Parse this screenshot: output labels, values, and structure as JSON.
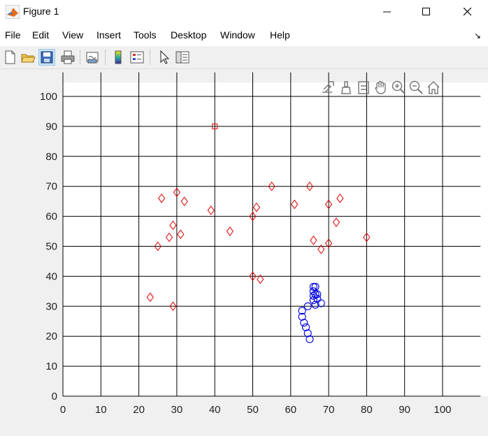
{
  "window": {
    "title": "Figure 1"
  },
  "menu": [
    "File",
    "Edit",
    "View",
    "Insert",
    "Tools",
    "Desktop",
    "Window",
    "Help"
  ],
  "toolbar_icons": [
    "new-figure-icon",
    "open-file-icon",
    "save-icon",
    "print-icon",
    "link-plot-icon",
    "insert-colorbar-icon",
    "insert-legend-icon",
    "edit-plot-icon",
    "property-inspector-icon"
  ],
  "axes_toolbar_icons": [
    "export-icon",
    "brush-icon",
    "data-tips-icon",
    "pan-icon",
    "zoom-in-icon",
    "zoom-out-icon",
    "home-icon"
  ],
  "colors": {
    "diamond": "#e00000",
    "circle": "#0000e0",
    "square": "#e00000",
    "grid": "#000000"
  },
  "chart_data": {
    "type": "scatter",
    "xlim": [
      0,
      110
    ],
    "ylim": [
      0,
      108
    ],
    "xticks": [
      0,
      10,
      20,
      30,
      40,
      50,
      60,
      70,
      80,
      90,
      100
    ],
    "yticks": [
      0,
      10,
      20,
      30,
      40,
      50,
      60,
      70,
      80,
      90,
      100
    ],
    "grid": true,
    "series": [
      {
        "marker": "diamond",
        "color": "#e00000",
        "points": [
          [
            23,
            33
          ],
          [
            25,
            50
          ],
          [
            26,
            66
          ],
          [
            28,
            53
          ],
          [
            29,
            57
          ],
          [
            29,
            30
          ],
          [
            30,
            68
          ],
          [
            31,
            54
          ],
          [
            32,
            65
          ],
          [
            39,
            62
          ],
          [
            44,
            55
          ],
          [
            50,
            60
          ],
          [
            50,
            40
          ],
          [
            51,
            63
          ],
          [
            52,
            39
          ],
          [
            55,
            70
          ],
          [
            61,
            64
          ],
          [
            65,
            70
          ],
          [
            66,
            52
          ],
          [
            68,
            49
          ],
          [
            70,
            64
          ],
          [
            70,
            51
          ],
          [
            72,
            58
          ],
          [
            73,
            66
          ],
          [
            80,
            53
          ]
        ]
      },
      {
        "marker": "circle",
        "color": "#0000e0",
        "points": [
          [
            65,
            19
          ],
          [
            64.5,
            21
          ],
          [
            64,
            23
          ],
          [
            63.5,
            24.5
          ],
          [
            63,
            26.5
          ],
          [
            63,
            28.5
          ],
          [
            64.5,
            30
          ],
          [
            66.5,
            30.5
          ],
          [
            68,
            31
          ],
          [
            66,
            32
          ],
          [
            67,
            32.5
          ],
          [
            66,
            33.5
          ],
          [
            66.5,
            34
          ],
          [
            67,
            34
          ],
          [
            66,
            35
          ],
          [
            66,
            36.5
          ],
          [
            66.5,
            36.5
          ]
        ]
      },
      {
        "marker": "square",
        "color": "#e00000",
        "points": [
          [
            40,
            90
          ]
        ]
      }
    ]
  }
}
